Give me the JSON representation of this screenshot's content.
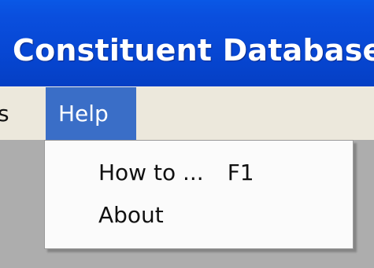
{
  "window": {
    "title": "Constituent Database"
  },
  "menubar": {
    "items": [
      {
        "label": "s"
      },
      {
        "label": "Help"
      }
    ]
  },
  "help_menu": {
    "items": [
      {
        "label": "How to ...",
        "shortcut": "F1"
      },
      {
        "label": "About"
      }
    ]
  },
  "colors": {
    "titlebar": "#0747d3",
    "menu_highlight": "#3a6ec7",
    "menubar": "#ece8dc",
    "background": "#adadad"
  }
}
